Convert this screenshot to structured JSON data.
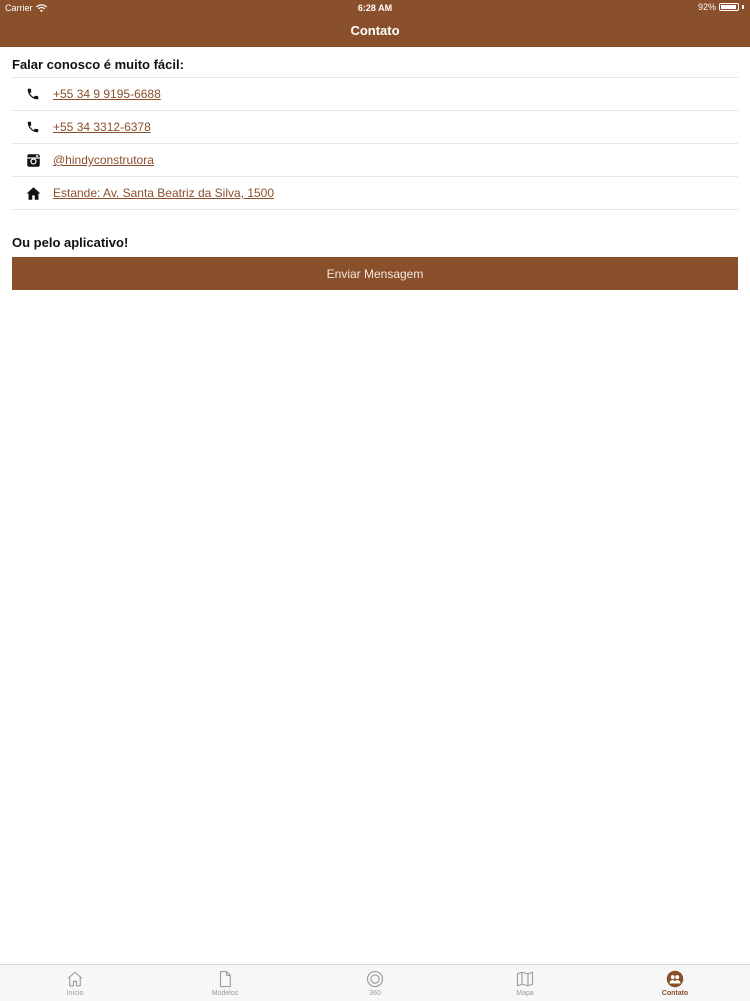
{
  "status_bar": {
    "carrier": "Carrier",
    "time": "6:28 AM",
    "battery": "92%",
    "battery_level": 0.92
  },
  "nav": {
    "title": "Contato"
  },
  "contact": {
    "heading": "Falar conosco é muito fácil:",
    "items": [
      {
        "icon": "phone-icon",
        "label": "+55 34 9 9195-6688"
      },
      {
        "icon": "phone-icon",
        "label": "+55 34 3312-6378"
      },
      {
        "icon": "instagram-icon",
        "label": "@hindyconstrutora"
      },
      {
        "icon": "home-icon",
        "label": "Estande: Av. Santa Beatriz da Silva, 1500"
      }
    ]
  },
  "app_section": {
    "heading": "Ou pelo aplicativo!",
    "button_label": "Enviar Mensagem"
  },
  "tabbar": {
    "items": [
      {
        "icon": "home-outline-icon",
        "label": "Início",
        "active": false
      },
      {
        "icon": "document-icon",
        "label": "Modelos",
        "active": false
      },
      {
        "icon": "circle-360-icon",
        "label": "360",
        "active": false
      },
      {
        "icon": "map-icon",
        "label": "Mapa",
        "active": false
      },
      {
        "icon": "contacts-icon",
        "label": "Contato",
        "active": true
      }
    ]
  },
  "colors": {
    "brand": "#8a4f2b",
    "tab_inactive": "#9b9b9b",
    "divider": "#e6e6e6"
  }
}
